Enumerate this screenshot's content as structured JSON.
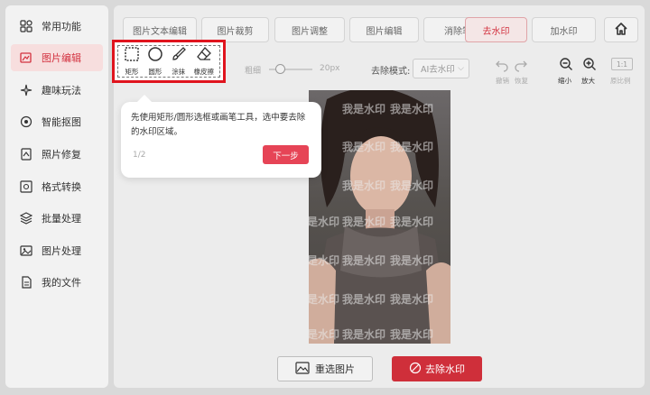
{
  "sidebar": {
    "items": [
      {
        "label": "常用功能",
        "icon": "grid-icon",
        "active": false
      },
      {
        "label": "图片编辑",
        "icon": "image-edit-icon",
        "active": true
      },
      {
        "label": "趣味玩法",
        "icon": "sparkle-icon",
        "active": false
      },
      {
        "label": "智能抠图",
        "icon": "target-icon",
        "active": false
      },
      {
        "label": "照片修复",
        "icon": "photo-repair-icon",
        "active": false
      },
      {
        "label": "格式转换",
        "icon": "convert-icon",
        "active": false
      },
      {
        "label": "批量处理",
        "icon": "layers-icon",
        "active": false
      },
      {
        "label": "图片处理",
        "icon": "image-icon",
        "active": false
      },
      {
        "label": "我的文件",
        "icon": "file-icon",
        "active": false
      }
    ]
  },
  "tabs": [
    {
      "label": "图片文本编辑"
    },
    {
      "label": "图片裁剪"
    },
    {
      "label": "图片调整"
    },
    {
      "label": "图片编辑"
    },
    {
      "label": "消除笔"
    },
    {
      "label": "去水印"
    },
    {
      "label": "加水印"
    }
  ],
  "tools": [
    {
      "label": "矩形",
      "icon": "rectangle-select-icon"
    },
    {
      "label": "圆形",
      "icon": "circle-select-icon"
    },
    {
      "label": "涂抹",
      "icon": "brush-icon"
    },
    {
      "label": "橡皮擦",
      "icon": "eraser-icon"
    }
  ],
  "toolbar": {
    "brush_size_label": "粗细",
    "brush_size_value": "20px",
    "mode_label": "去除模式:",
    "mode_value": "AI去水印",
    "undo_label": "撤销",
    "redo_label": "恢复",
    "zoom_out_label": "缩小",
    "zoom_in_label": "放大",
    "ratio_value": "1:1",
    "original_label": "原比例"
  },
  "watermark_text": "我是水印",
  "buttons": {
    "reselect": "重选图片",
    "remove": "去除水印"
  },
  "tooltip": {
    "text": "先使用矩形/圆形选框或画笔工具，选中要去除的水印区域。",
    "page": "1/2",
    "next": "下一步"
  },
  "colors": {
    "accent": "#d3313f",
    "highlight_border": "#e0141e",
    "next_button": "#e64456"
  }
}
